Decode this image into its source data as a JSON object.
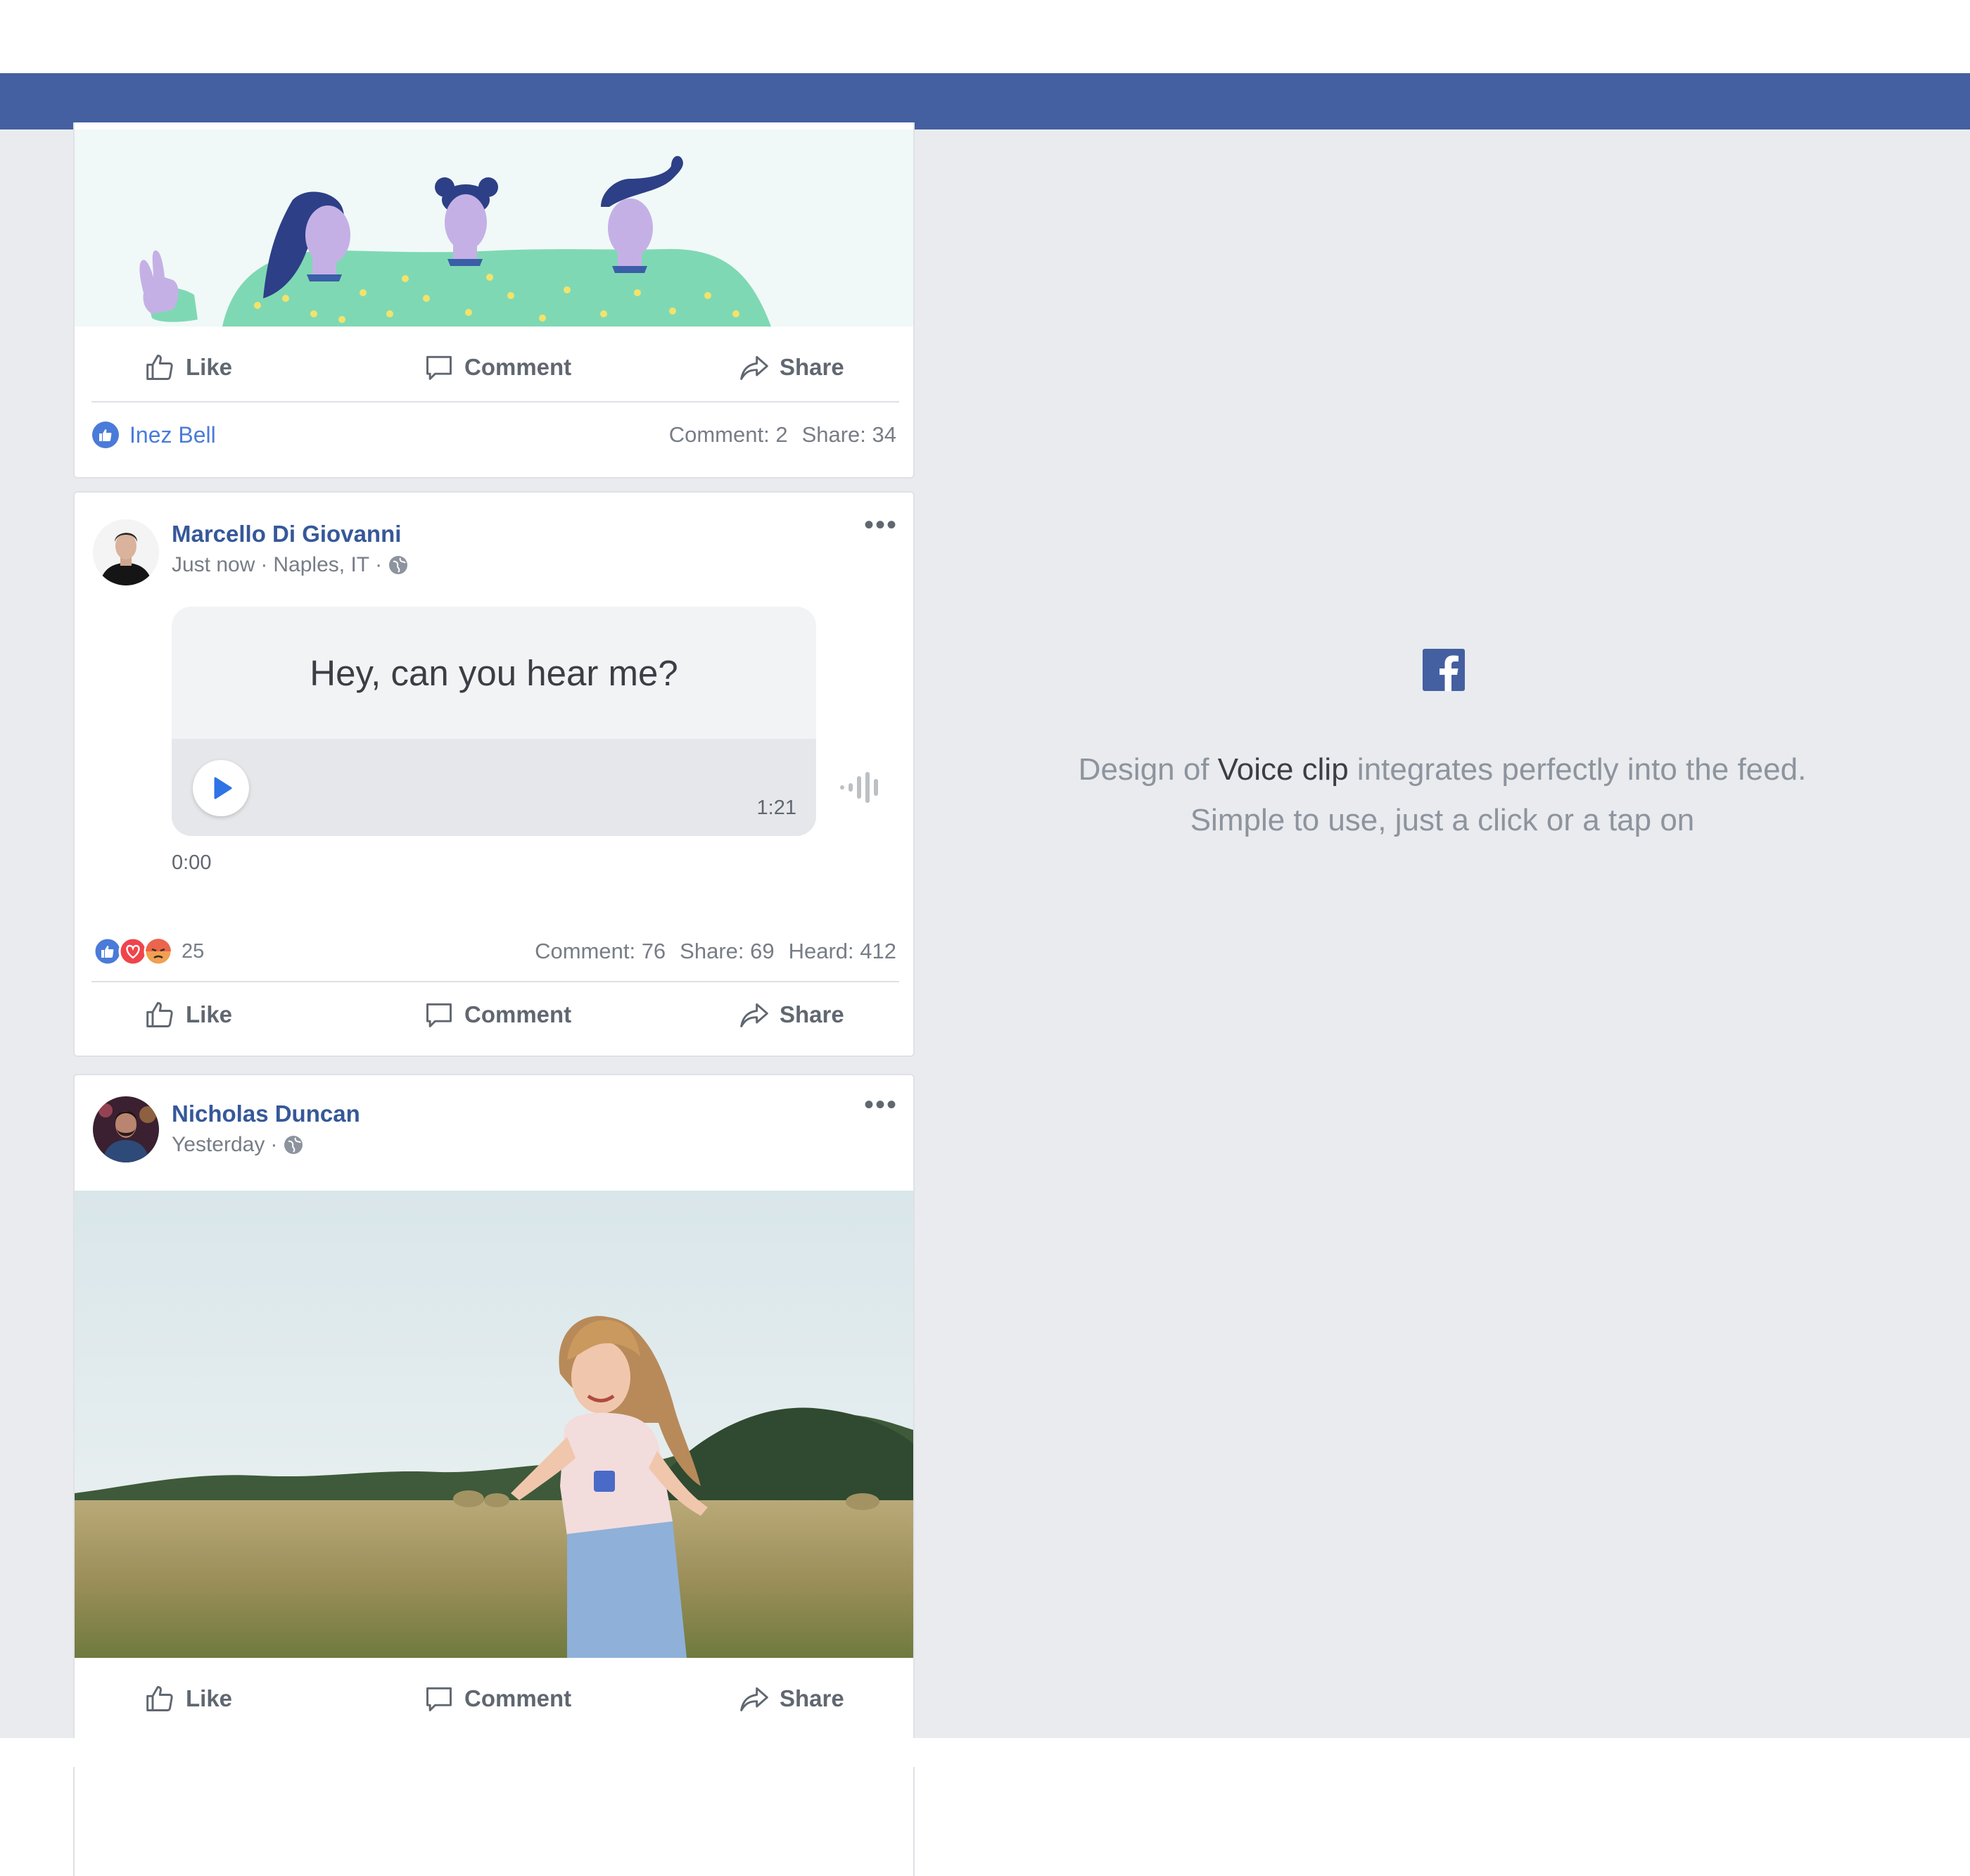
{
  "colors": {
    "brand_blue": "#4460a0",
    "page_bg": "#e9ebee",
    "link_blue": "#365899",
    "like_blue": "#4a7bd8",
    "love_red": "#f0444b",
    "angry_orange": "#f0a050",
    "illustration_bg": "#f0f9f7",
    "sweater_green": "#7fd8b4",
    "skin_purple": "#c5b0e6"
  },
  "feed": {
    "actions": {
      "like": "Like",
      "comment": "Comment",
      "share": "Share"
    },
    "post1": {
      "liked_by": "Inez Bell",
      "comment_count": "Comment: 2",
      "share_count": "Share: 34"
    },
    "post2": {
      "author": "Marcello Di Giovanni",
      "time": "Just now",
      "location": "Naples, IT",
      "voice_clip": {
        "transcript": "Hey, can you hear me?",
        "duration": "1:21",
        "elapsed": "0:00"
      },
      "reaction_count": "25",
      "comment_count": "Comment: 76",
      "share_count": "Share: 69",
      "heard_count": "Heard: 412"
    },
    "post3": {
      "author": "Nicholas Duncan",
      "time": "Yesterday"
    }
  },
  "side_panel": {
    "line1_before": "Design of",
    "line1_highlight": "Voice clip",
    "line1_after": "integrates perfectly into the feed.",
    "line2": "Simple to use, just a click or a tap on"
  },
  "icons": [
    "thumbs-up-icon",
    "comment-icon",
    "share-icon",
    "globe-icon",
    "play-icon",
    "waveform-icon",
    "more-icon",
    "facebook-logo-icon",
    "love-reaction-icon",
    "angry-reaction-icon"
  ]
}
